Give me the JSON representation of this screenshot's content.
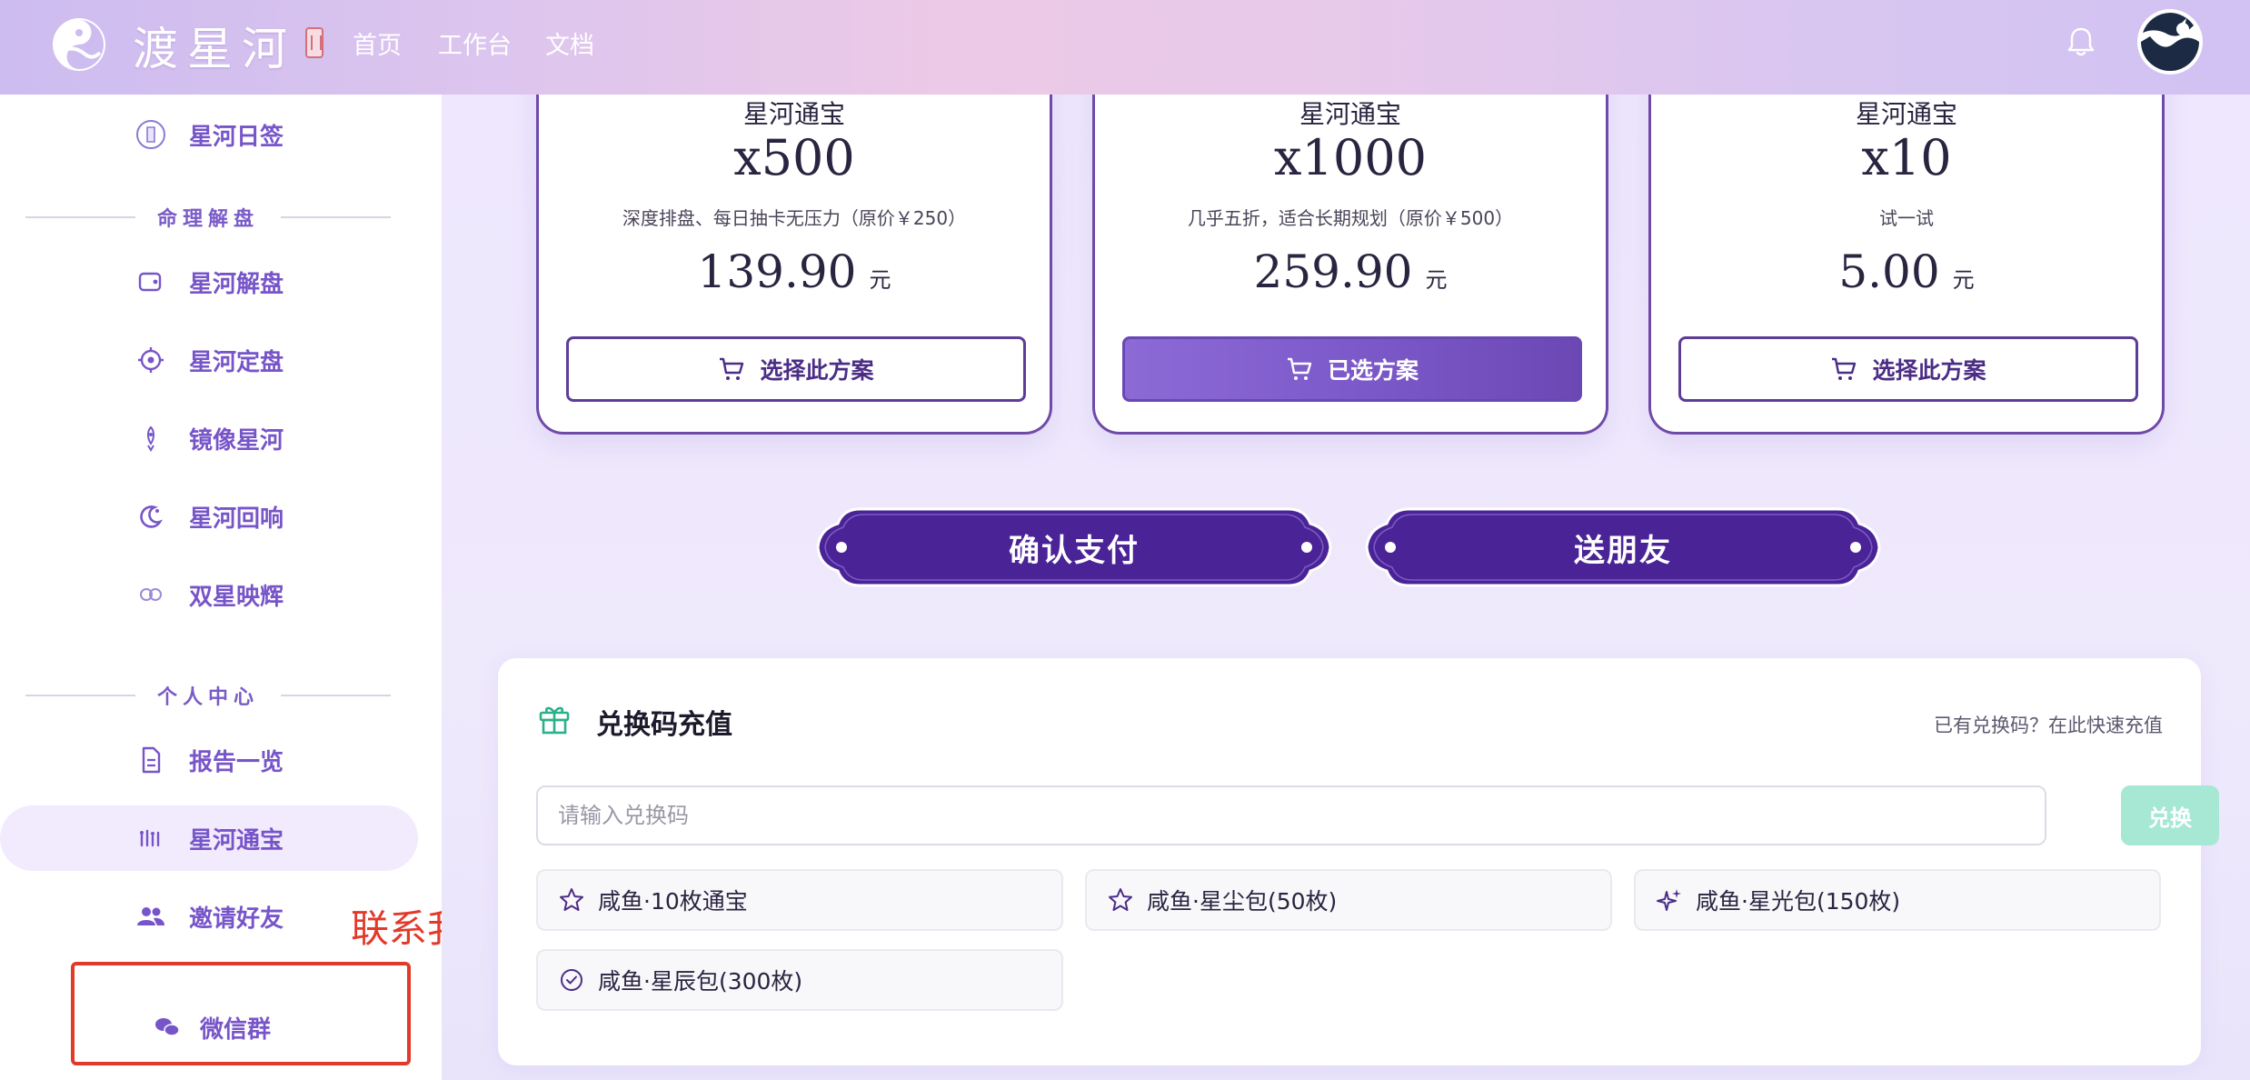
{
  "header": {
    "brand": "渡星河",
    "nav": [
      {
        "label": "首页"
      },
      {
        "label": "工作台"
      },
      {
        "label": "文档"
      }
    ]
  },
  "sidebar": {
    "top_item": {
      "label": "星河日签",
      "icon": "sign-icon"
    },
    "sections": [
      {
        "title": "命理解盘",
        "items": [
          {
            "label": "星河解盘",
            "icon": "wallet-icon"
          },
          {
            "label": "星河定盘",
            "icon": "target-icon"
          },
          {
            "label": "镜像星河",
            "icon": "rocket-icon"
          },
          {
            "label": "星河回响",
            "icon": "moon-icon"
          },
          {
            "label": "双星映辉",
            "icon": "double-star-icon"
          }
        ]
      },
      {
        "title": "个人中心",
        "items": [
          {
            "label": "报告一览",
            "icon": "document-icon"
          },
          {
            "label": "星河通宝",
            "icon": "coins-icon",
            "active": true
          },
          {
            "label": "邀请好友",
            "icon": "people-icon"
          }
        ]
      }
    ],
    "contact_annotation": "联系我们",
    "wechat": {
      "label": "微信群",
      "icon": "wechat-icon"
    }
  },
  "plans": [
    {
      "name": "星河通宝",
      "quantity": "x500",
      "description": "深度排盘、每日抽卡无压力（原价￥250）",
      "price": "139.90",
      "unit": "元",
      "button": "选择此方案",
      "selected": false
    },
    {
      "name": "星河通宝",
      "quantity": "x1000",
      "description": "几乎五折，适合长期规划（原价￥500）",
      "price": "259.90",
      "unit": "元",
      "button": "已选方案",
      "selected": true
    },
    {
      "name": "星河通宝",
      "quantity": "x10",
      "description": "试一试",
      "price": "5.00",
      "unit": "元",
      "button": "选择此方案",
      "selected": false
    }
  ],
  "actions": {
    "confirm": "确认支付",
    "gift": "送朋友"
  },
  "redeem": {
    "title": "兑换码充值",
    "hint": "已有兑换码？在此快速充值",
    "placeholder": "请输入兑换码",
    "button": "兑换",
    "options": [
      {
        "label": "咸鱼·10枚通宝",
        "icon": "star-icon"
      },
      {
        "label": "咸鱼·星尘包(50枚)",
        "icon": "star-icon"
      },
      {
        "label": "咸鱼·星光包(150枚)",
        "icon": "sparkle-icon"
      },
      {
        "label": "咸鱼·星辰包(300枚)",
        "icon": "check-circle-icon"
      }
    ]
  },
  "colors": {
    "accent": "#7755c9",
    "primary_dark": "#4a2497",
    "annotation": "#e23a2a",
    "redeem_button": "#a6e8d3",
    "gift_icon": "#2bb08a"
  }
}
